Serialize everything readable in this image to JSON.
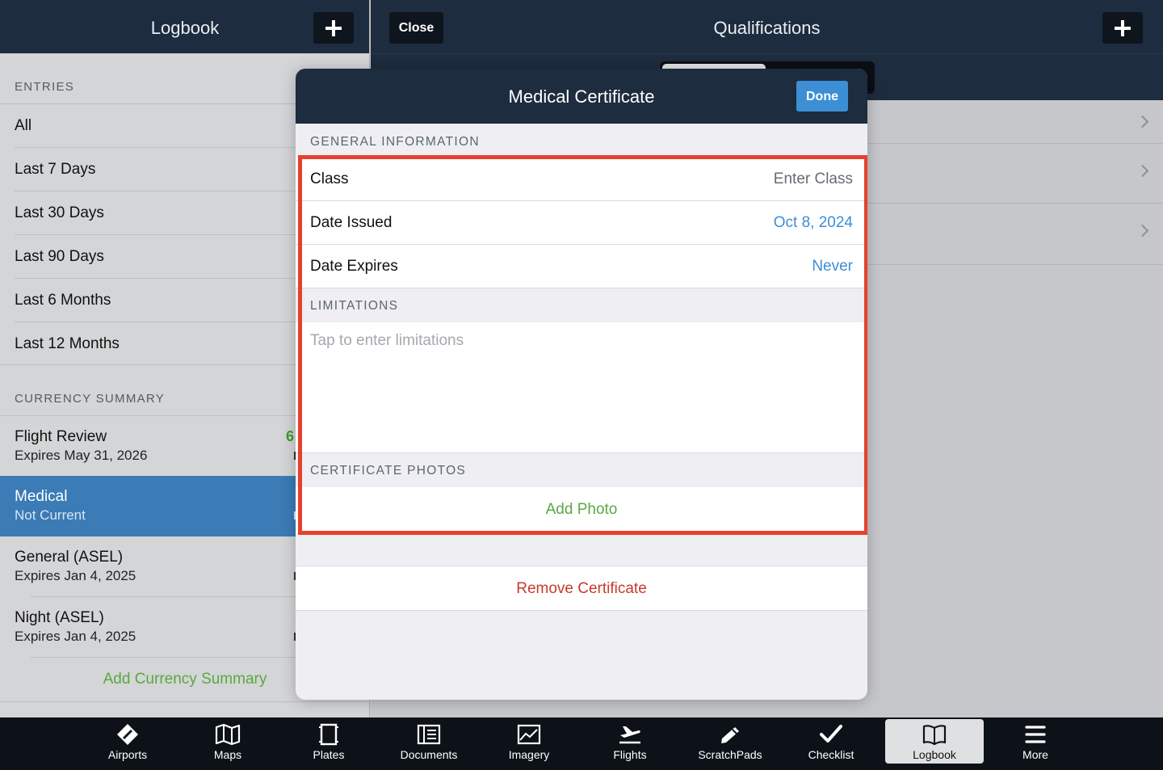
{
  "left": {
    "title": "Logbook",
    "entries_header": "ENTRIES",
    "entries": [
      "All",
      "Last 7 Days",
      "Last 30 Days",
      "Last 90 Days",
      "Last 6 Months",
      "Last 12 Months"
    ],
    "currency_header": "CURRENCY SUMMARY",
    "currency": [
      {
        "title": "Flight Review",
        "sub": "Expires May 31, 2026",
        "value": "6"
      },
      {
        "title": "Medical",
        "sub": "Not Current"
      },
      {
        "title": "General (ASEL)",
        "sub": "Expires Jan 4, 2025"
      },
      {
        "title": "Night (ASEL)",
        "sub": "Expires Jan 4, 2025"
      }
    ],
    "add_currency": "Add Currency Summary"
  },
  "right": {
    "close_label": "Close",
    "title": "Qualifications"
  },
  "modal": {
    "title": "Medical Certificate",
    "done_label": "Done",
    "general_header": "GENERAL INFORMATION",
    "class_label": "Class",
    "class_placeholder": "Enter Class",
    "issued_label": "Date Issued",
    "issued_value": "Oct 8, 2024",
    "expires_label": "Date Expires",
    "expires_value": "Never",
    "limitations_header": "LIMITATIONS",
    "limitations_placeholder": "Tap to enter limitations",
    "photos_header": "CERTIFICATE PHOTOS",
    "add_photo": "Add Photo",
    "remove": "Remove Certificate"
  },
  "colors": {
    "header_navy": "#1d2c3e",
    "selection_blue": "#3b7bb6",
    "accent_blue": "#3c8fd4",
    "green": "#5aa843",
    "red": "#c9392d",
    "highlight": "#e8402e"
  },
  "tabs": [
    {
      "label": "Airports",
      "icon": "airports-icon"
    },
    {
      "label": "Maps",
      "icon": "maps-icon"
    },
    {
      "label": "Plates",
      "icon": "plates-icon"
    },
    {
      "label": "Documents",
      "icon": "documents-icon"
    },
    {
      "label": "Imagery",
      "icon": "imagery-icon"
    },
    {
      "label": "Flights",
      "icon": "flights-icon"
    },
    {
      "label": "ScratchPads",
      "icon": "scratchpads-icon"
    },
    {
      "label": "Checklist",
      "icon": "checklist-icon"
    },
    {
      "label": "Logbook",
      "icon": "logbook-icon",
      "active": true
    },
    {
      "label": "More",
      "icon": "more-icon"
    }
  ]
}
